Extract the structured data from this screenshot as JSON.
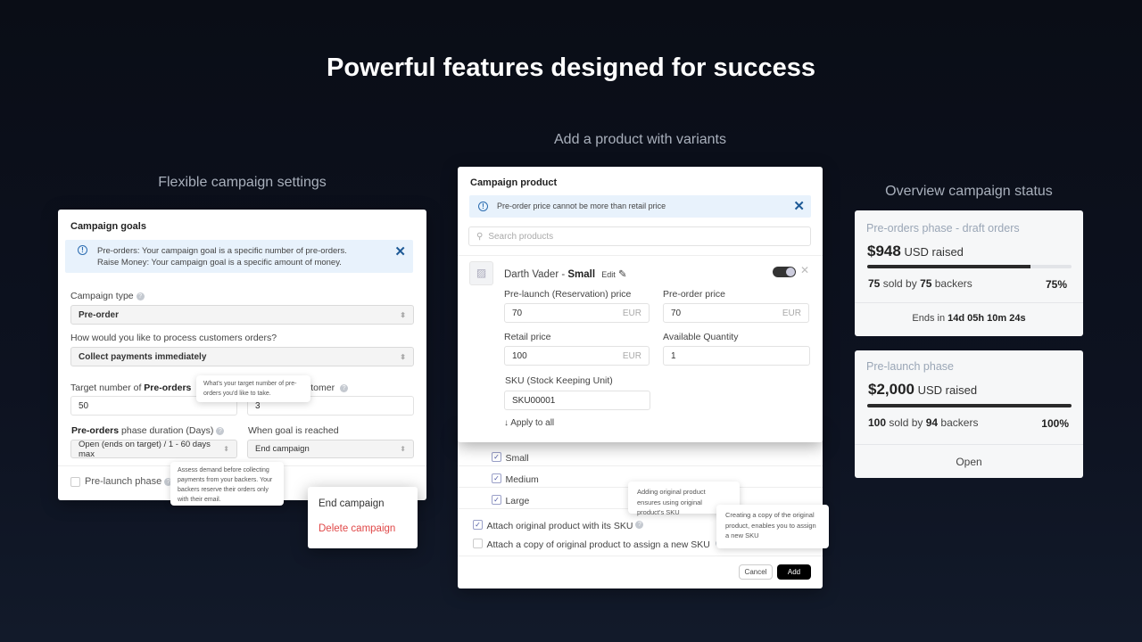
{
  "headline": "Powerful features designed for success",
  "left": {
    "caption": "Flexible campaign settings",
    "title": "Campaign goals",
    "info_line1": "Pre-orders: Your campaign goal is a specific number of pre-orders.",
    "info_line2": "Raise Money: Your campaign goal is a specific amount of money.",
    "campaign_type_label": "Campaign type",
    "campaign_type_value": "Pre-order",
    "process_label": "How would you like to process customers orders?",
    "process_value": "Collect payments immediately",
    "target_label_prefix": "Target number of ",
    "target_label_bold": "Pre-orders",
    "target_value": "50",
    "limit_label_visible": "stomer",
    "limit_value": "3",
    "target_tooltip": "What's your target number of pre-orders you'd like to take.",
    "duration_label_bold": "Pre-orders",
    "duration_label_rest": " phase duration (Days)",
    "duration_value": "Open (ends on target) / 1 - 60 days max",
    "goal_label": "When goal is reached",
    "goal_value": "End campaign",
    "prelaunch_label": "Pre-launch phase",
    "prelaunch_checked": false,
    "prelaunch_tooltip": "Assess demand before collecting payments from your backers. Your backers reserve their orders only with their email.",
    "menu": [
      {
        "label": "End campaign",
        "color": "#333333"
      },
      {
        "label": "Delete campaign",
        "color": "#e04848"
      }
    ]
  },
  "middle": {
    "caption": "Add a product with variants",
    "title": "Campaign product",
    "info": "Pre-order price cannot be more than retail price",
    "search_placeholder": "Search products",
    "product_name": "Darth Vader - ",
    "product_variant": "Small",
    "edit_label": "Edit",
    "enabled": true,
    "prelaunch_price_label": "Pre-launch (Reservation) price",
    "prelaunch_price": "70",
    "preorder_price_label": "Pre-order price",
    "preorder_price": "70",
    "retail_price_label": "Retail price",
    "retail_price": "100",
    "currency": "EUR",
    "qty_label": "Available Quantity",
    "qty": "1",
    "sku_label": "SKU (Stock Keeping Unit)",
    "sku": "SKU00001",
    "apply_all": "Apply to all",
    "variants": [
      {
        "label": "Small",
        "checked": true
      },
      {
        "label": "Medium",
        "checked": true
      },
      {
        "label": "Large",
        "checked": true
      }
    ],
    "attach_original": "Attach original product with its SKU",
    "attach_original_checked": true,
    "attach_copy": "Attach a copy of original product to assign a new SKU",
    "attach_copy_checked": false,
    "tip_original": "Adding original product ensures using original product's SKU",
    "tip_copy": "Creating a copy of the original product, enables you to assign a new SKU",
    "cancel": "Cancel",
    "add": "Add"
  },
  "right": {
    "caption": "Overview campaign status",
    "cards": [
      {
        "phase": "Pre-orders phase - draft orders",
        "amount": "$948",
        "amount_suffix": " USD raised",
        "sold": "75",
        "sold_mid": " sold by ",
        "backers": "75",
        "backers_suffix": " backers",
        "percent": "75%",
        "progress": 0.8,
        "footer_prefix": "Ends in ",
        "footer_bold": "14d 05h 10m 24s"
      },
      {
        "phase": "Pre-launch phase",
        "amount": "$2,000",
        "amount_suffix": " USD raised",
        "sold": "100",
        "sold_mid": " sold by ",
        "backers": "94",
        "backers_suffix": " backers",
        "percent": "100%",
        "progress": 1.0,
        "footer_prefix": "Open",
        "footer_bold": ""
      }
    ]
  }
}
